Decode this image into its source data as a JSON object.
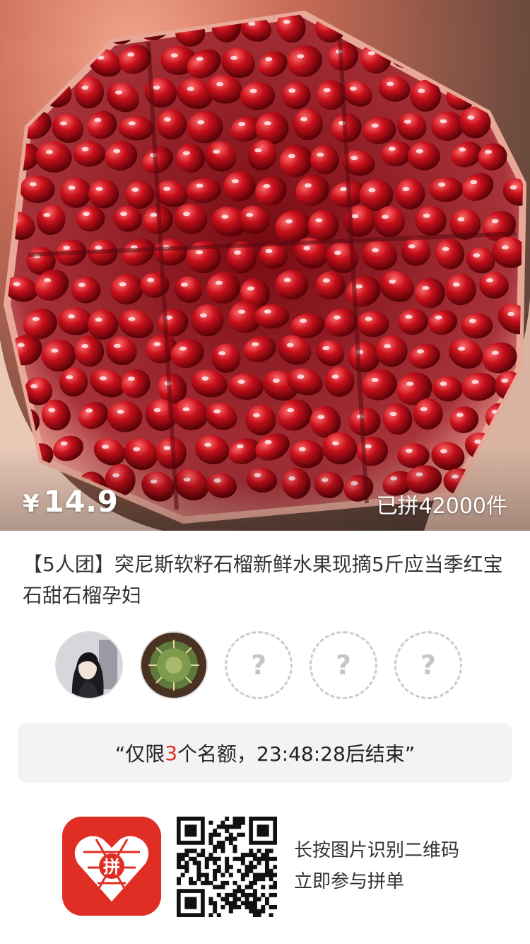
{
  "product": {
    "price_currency": "¥",
    "price_amount": "14.9",
    "sold_count": "已拼42000件",
    "title": "【5人团】突尼斯软籽石榴新鲜水果现摘5斤应当季红宝石甜石榴孕妇"
  },
  "group": {
    "placeholder_symbol": "?",
    "members": [
      {
        "filled": true,
        "icon": "user-avatar-girl"
      },
      {
        "filled": true,
        "icon": "user-avatar-cactus"
      },
      {
        "filled": false
      },
      {
        "filled": false
      },
      {
        "filled": false
      }
    ]
  },
  "quota": {
    "prefix": "“仅限",
    "count": "3",
    "suffix": "个名额，23:48:28后结束”"
  },
  "footer": {
    "logo_text": "拼",
    "hint_line1": "长按图片识别二维码",
    "hint_line2": "立即参与拼单"
  },
  "colors": {
    "accent": "#e02e24",
    "title_text": "#333333",
    "quota_bg": "#f4f2f4",
    "pomegranate": "#b3121f"
  }
}
